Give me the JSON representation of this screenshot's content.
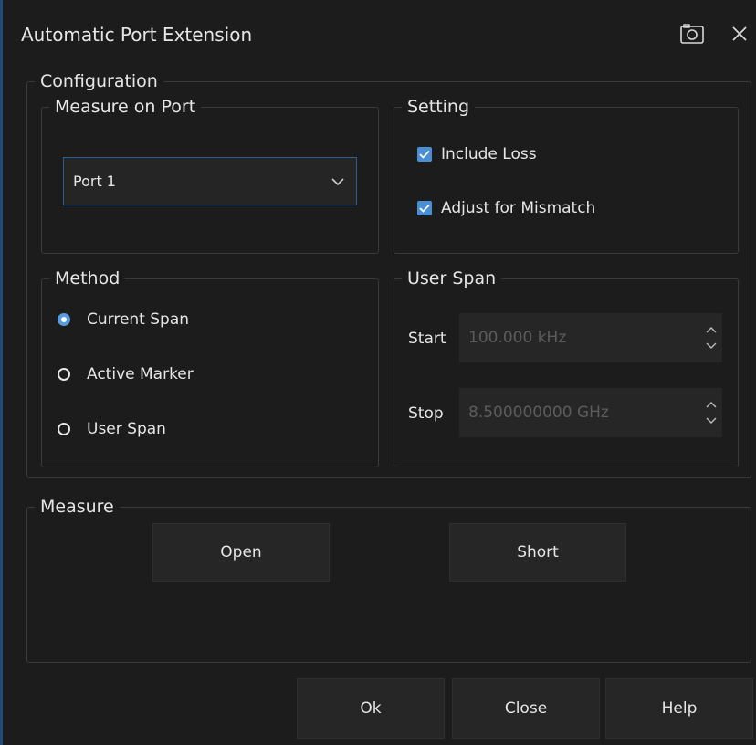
{
  "window": {
    "title": "Automatic Port Extension",
    "camera_icon": "camera-icon",
    "close_icon": "close-icon"
  },
  "configuration": {
    "legend": "Configuration",
    "measure_on_port": {
      "legend": "Measure on Port",
      "selected": "Port 1",
      "dropdown_icon": "chevron-down-icon"
    },
    "setting": {
      "legend": "Setting",
      "include_loss": {
        "label": "Include Loss",
        "checked": true
      },
      "adjust_mismatch": {
        "label": "Adjust for Mismatch",
        "checked": true
      }
    },
    "method": {
      "legend": "Method",
      "options": [
        "Current Span",
        "Active Marker",
        "User Span"
      ],
      "selected": "Current Span"
    },
    "user_span": {
      "legend": "User Span",
      "start_label": "Start",
      "start_value": "100.000 kHz",
      "stop_label": "Stop",
      "stop_value": "8.500000000 GHz"
    }
  },
  "measure": {
    "legend": "Measure",
    "open_label": "Open",
    "short_label": "Short"
  },
  "footer": {
    "ok_label": "Ok",
    "close_label": "Close",
    "help_label": "Help"
  },
  "colors": {
    "accent": "#4a8fd6",
    "background": "#1c1c1c",
    "border": "#3a3a3a"
  }
}
